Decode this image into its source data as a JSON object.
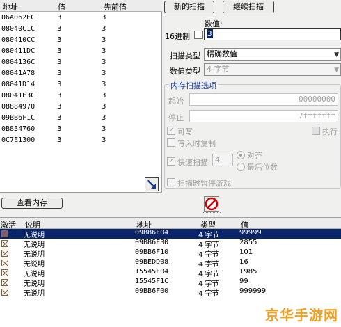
{
  "found_list": {
    "headers": {
      "address": "地址",
      "value": "值",
      "previous": "先前值"
    },
    "rows": [
      {
        "address": "06A062EC",
        "value": "3",
        "previous": "3"
      },
      {
        "address": "08040C1C",
        "value": "3",
        "previous": "3"
      },
      {
        "address": "080410CC",
        "value": "3",
        "previous": "3"
      },
      {
        "address": "080411DC",
        "value": "3",
        "previous": "3"
      },
      {
        "address": "0804136C",
        "value": "3",
        "previous": "3"
      },
      {
        "address": "08041A78",
        "value": "3",
        "previous": "3"
      },
      {
        "address": "08041D14",
        "value": "3",
        "previous": "3"
      },
      {
        "address": "08041E3C",
        "value": "3",
        "previous": "3"
      },
      {
        "address": "08884970",
        "value": "3",
        "previous": "3"
      },
      {
        "address": "09BB6F1C",
        "value": "3",
        "previous": "3"
      },
      {
        "address": "0B834760",
        "value": "3",
        "previous": "3"
      },
      {
        "address": "0C7E1300",
        "value": "3",
        "previous": "3"
      }
    ]
  },
  "scan": {
    "new_scan": "新的扫描",
    "next_scan": "继续扫描",
    "value_label": "数值:",
    "hex_label": "16进制",
    "value": "3",
    "scan_type_label": "扫描类型",
    "scan_type": "精确数值",
    "value_type_label": "数值类型",
    "value_type": "4 字节"
  },
  "memory_options": {
    "title": "内存扫描选项",
    "start_label": "起始",
    "start_value": "00000000",
    "stop_label": "停止",
    "stop_value": "7fffffff",
    "writable": "可写",
    "executable": "执行",
    "copy_on_write": "写入时复制",
    "fast_scan": "快速扫描",
    "fast_scan_value": "4",
    "align": "对齐",
    "last_digits": "最后位数",
    "pause_game": "扫描时暂停游戏"
  },
  "view_memory": "查看内存",
  "address_table": {
    "headers": {
      "active": "激活",
      "description": "说明",
      "address": "地址",
      "type": "类型",
      "value": "值"
    },
    "rows": [
      {
        "description": "无说明",
        "address": "09BB6F04",
        "type": "4 字节",
        "value": "99999"
      },
      {
        "description": "无说明",
        "address": "09BB6F30",
        "type": "4 字节",
        "value": "2855"
      },
      {
        "description": "无说明",
        "address": "09BB6F10",
        "type": "4 字节",
        "value": "101"
      },
      {
        "description": "无说明",
        "address": "09BEDD08",
        "type": "4 字节",
        "value": "16"
      },
      {
        "description": "无说明",
        "address": "15545F04",
        "type": "4 字节",
        "value": "1985"
      },
      {
        "description": "无说明",
        "address": "15545F1C",
        "type": "4 字节",
        "value": "99"
      },
      {
        "description": "无说明",
        "address": "09BB6F00",
        "type": "4 字节",
        "value": "999999"
      }
    ]
  },
  "watermark": "京华手游网",
  "colors": {
    "selection": "#0a246a",
    "watermark": "#f0a020",
    "stop_icon": "#cc0000"
  }
}
